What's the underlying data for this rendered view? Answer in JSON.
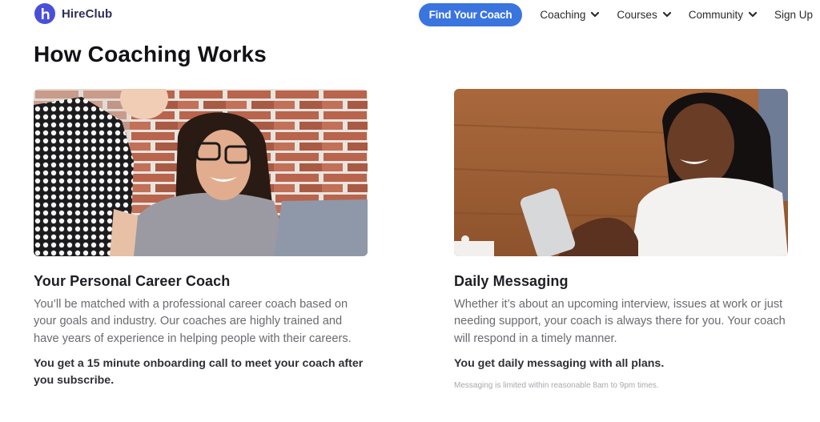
{
  "brand": {
    "name": "HireClub",
    "logo_icon": "hireclub-h-logo-icon",
    "color": "#4a4fd8"
  },
  "nav": {
    "cta_label": "Find Your Coach",
    "cta_color": "#3a74df",
    "items": [
      {
        "label": "Coaching",
        "icon": "chevron-down-icon"
      },
      {
        "label": "Courses",
        "icon": "chevron-down-icon"
      },
      {
        "label": "Community",
        "icon": "chevron-down-icon"
      }
    ],
    "signup_label": "Sign Up"
  },
  "page": {
    "title": "How Coaching Works"
  },
  "cards": [
    {
      "image_alt": "Two smiling women looking at a laptop in front of a brick wall",
      "title": "Your Personal Career Coach",
      "description": "You’ll be matched with a professional career coach based on your goals and industry. Our coaches are highly trained and have years of experience in helping people with their careers.",
      "highlight": "You get a 15 minute onboarding call to meet your coach after you subscribe."
    },
    {
      "image_alt": "Smiling woman looking at her smartphone in front of a wooden wall",
      "title": "Daily Messaging",
      "description": "Whether it’s about an upcoming interview, issues at work or just needing support, your coach is always there for you. Your coach will respond in a timely manner.",
      "highlight": "You get daily messaging with all plans.",
      "note": "Messaging is limited within reasonable 8am to 9pm times."
    }
  ]
}
